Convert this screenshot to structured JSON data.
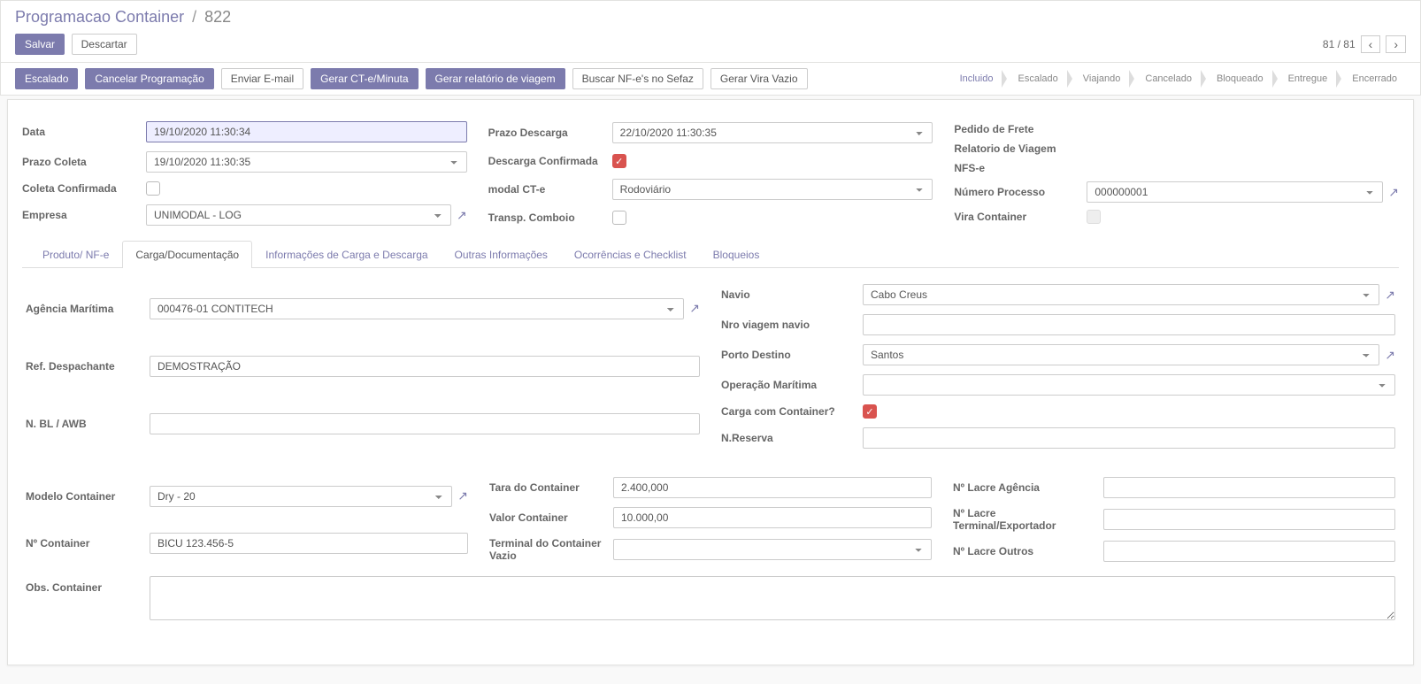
{
  "breadcrumb": {
    "root": "Programacao Container",
    "current": "822"
  },
  "buttons": {
    "save": "Salvar",
    "discard": "Descartar",
    "escalado": "Escalado",
    "cancelar_prog": "Cancelar Programação",
    "enviar_email": "Enviar E-mail",
    "gerar_cte": "Gerar CT-e/Minuta",
    "gerar_relatorio": "Gerar relatório de viagem",
    "buscar_nfe": "Buscar NF-e's no Sefaz",
    "gerar_vira": "Gerar Vira Vazio"
  },
  "pager": {
    "current": "81",
    "total": "81"
  },
  "status": {
    "steps": [
      "Incluido",
      "Escalado",
      "Viajando",
      "Cancelado",
      "Bloqueado",
      "Entregue",
      "Encerrado"
    ],
    "active": "Incluido"
  },
  "labels": {
    "data": "Data",
    "prazo_coleta": "Prazo Coleta",
    "coleta_confirmada": "Coleta Confirmada",
    "empresa": "Empresa",
    "prazo_descarga": "Prazo Descarga",
    "descarga_confirmada": "Descarga Confirmada",
    "modal_cte": "modal CT-e",
    "transp_comboio": "Transp. Comboio",
    "pedido_frete": "Pedido de Frete",
    "relatorio_viagem": "Relatorio de Viagem",
    "nfse": "NFS-e",
    "numero_processo": "Número Processo",
    "vira_container": "Vira Container",
    "agencia_maritima": "Agência Marítima",
    "ref_despachante": "Ref. Despachante",
    "n_bl_awb": "N. BL / AWB",
    "navio": "Navio",
    "nro_viagem": "Nro viagem navio",
    "porto_destino": "Porto Destino",
    "operacao_maritima": "Operação Marítima",
    "carga_container": "Carga com Container?",
    "n_reserva": "N.Reserva",
    "modelo_container": "Modelo Container",
    "n_container": "Nº Container",
    "tara_container": "Tara do Container",
    "valor_container": "Valor Container",
    "terminal_vazio": "Terminal do Container Vazio",
    "lacre_agencia": "Nº Lacre Agência",
    "lacre_terminal": "Nº Lacre Terminal/Exportador",
    "lacre_outros": "Nº Lacre Outros",
    "obs_container": "Obs. Container"
  },
  "values": {
    "data": "19/10/2020 11:30:34",
    "prazo_coleta": "19/10/2020 11:30:35",
    "empresa": "UNIMODAL - LOG",
    "prazo_descarga": "22/10/2020 11:30:35",
    "modal_cte": "Rodoviário",
    "numero_processo": "000000001",
    "agencia_maritima": "000476-01 CONTITECH",
    "ref_despachante": "DEMOSTRAÇÃO",
    "n_bl_awb": "",
    "navio": "Cabo Creus",
    "nro_viagem": "",
    "porto_destino": "Santos",
    "operacao_maritima": "",
    "n_reserva": "",
    "modelo_container": "Dry - 20",
    "n_container": "BICU 123.456-5",
    "tara_container": "2.400,000",
    "valor_container": "10.000,00",
    "terminal_vazio": "",
    "lacre_agencia": "",
    "lacre_terminal": "",
    "lacre_outros": "",
    "obs_container": ""
  },
  "tabs": [
    "Produto/ NF-e",
    "Carga/Documentação",
    "Informações de Carga e Descarga",
    "Outras Informações",
    "Ocorrências e Checklist",
    "Bloqueios"
  ],
  "active_tab": 1
}
